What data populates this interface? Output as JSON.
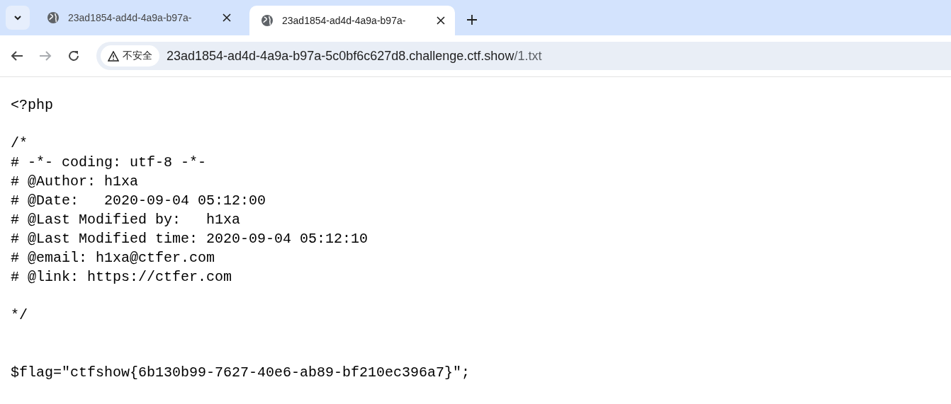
{
  "tabs": [
    {
      "title": "23ad1854-ad4d-4a9a-b97a-",
      "selected": false
    },
    {
      "title": "23ad1854-ad4d-4a9a-b97a-",
      "selected": true
    }
  ],
  "address_bar": {
    "security_label": "不安全",
    "host": "23ad1854-ad4d-4a9a-b97a-5c0bf6c627d8.challenge.ctf.show",
    "path": "/1.txt"
  },
  "document": {
    "blocks": [
      {
        "kind": "opening",
        "lines": [
          "<?php"
        ]
      },
      {
        "kind": "comment",
        "lines": [
          "/*",
          "# -*- coding: utf-8 -*-",
          "# @Author: h1xa",
          "# @Date:   2020-09-04 05:12:00",
          "# @Last Modified by:   h1xa",
          "# @Last Modified time: 2020-09-04 05:12:10",
          "# @email: h1xa@ctfer.com",
          "# @link: https://ctfer.com"
        ]
      },
      {
        "kind": "closing",
        "lines": [
          "*/"
        ]
      },
      {
        "kind": "statement",
        "lines": [
          "$flag=\"ctfshow{6b130b99-7627-40e6-ab89-bf210ec396a7}\";"
        ]
      }
    ]
  }
}
